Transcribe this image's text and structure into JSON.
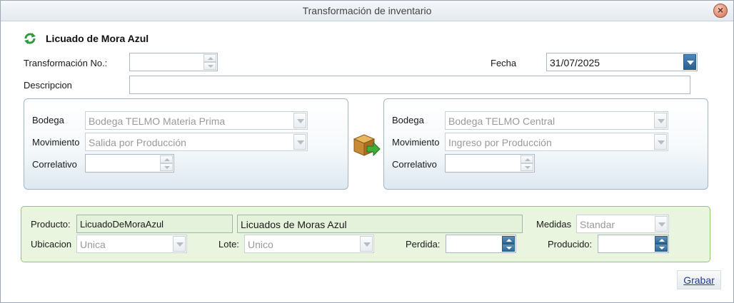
{
  "window": {
    "title": "Transformación de inventario"
  },
  "header": {
    "title": "Licuado de Mora Azul",
    "icon": "refresh-icon"
  },
  "form": {
    "transformacion_label": "Transformación No.:",
    "transformacion_value": "",
    "fecha_label": "Fecha",
    "fecha_value": "31/07/2025",
    "descripcion_label": "Descripcion",
    "descripcion_value": ""
  },
  "origen": {
    "bodega_label": "Bodega",
    "bodega_value": "Bodega TELMO Materia Prima",
    "movimiento_label": "Movimiento",
    "movimiento_value": "Salida por Producción",
    "correlativo_label": "Correlativo",
    "correlativo_value": ""
  },
  "destino": {
    "bodega_label": "Bodega",
    "bodega_value": "Bodega TELMO Central",
    "movimiento_label": "Movimiento",
    "movimiento_value": "Ingreso por Producción",
    "correlativo_label": "Correlativo",
    "correlativo_value": ""
  },
  "producto": {
    "producto_label": "Producto:",
    "codigo_value": "LicuadoDeMoraAzul",
    "nombre_value": "Licuados de Moras Azul",
    "medidas_label": "Medidas",
    "medidas_value": "Standar",
    "ubicacion_label": "Ubicacion",
    "ubicacion_value": "Unica",
    "lote_label": "Lote:",
    "lote_value": "Unico",
    "perdida_label": "Perdida:",
    "perdida_value": "",
    "producido_label": "Producido:",
    "producido_value": ""
  },
  "actions": {
    "grabar_label": "Grabar"
  },
  "colors": {
    "accent": "#2f6896",
    "product_bg": "#eaf5e0",
    "link": "#1f3f8a"
  }
}
